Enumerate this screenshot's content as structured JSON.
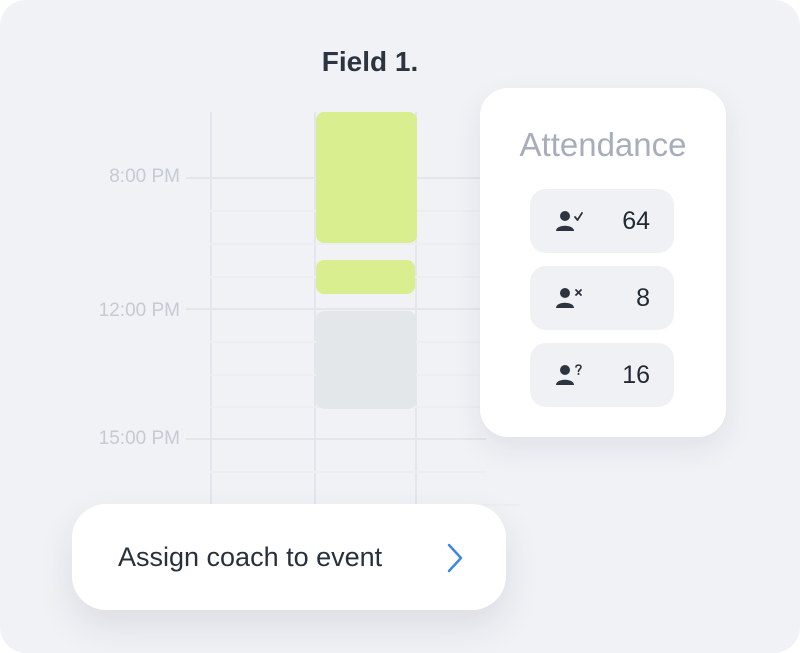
{
  "schedule": {
    "field_title": "Field 1.",
    "time_labels": [
      "8:00 PM",
      "12:00 PM",
      "15:00 PM"
    ]
  },
  "attendance": {
    "title": "Attendance",
    "rows": [
      {
        "icon": "user-check-icon",
        "value": "64"
      },
      {
        "icon": "user-x-icon",
        "value": "8"
      },
      {
        "icon": "user-question-icon",
        "value": "16"
      }
    ]
  },
  "assign": {
    "label": "Assign coach to event",
    "icon": "chevron-right-icon"
  },
  "colors": {
    "background": "#f1f2f6",
    "event_green": "#d8ee8f",
    "event_gray": "#e4e7ea",
    "accent_blue": "#3a86e8",
    "muted_text": "#a7aebb"
  }
}
